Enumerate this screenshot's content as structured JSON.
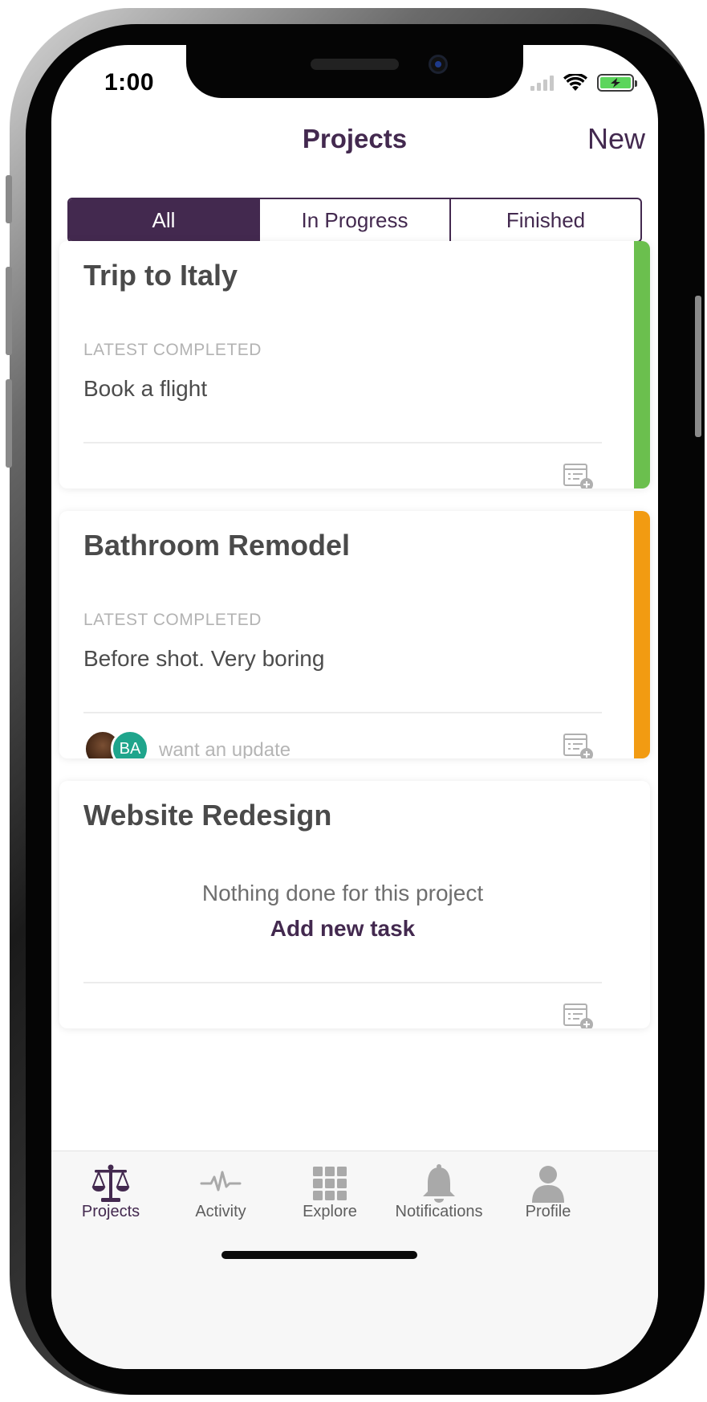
{
  "status_bar": {
    "time": "1:00"
  },
  "nav": {
    "title": "Projects",
    "action": "New"
  },
  "segments": [
    {
      "label": "All",
      "active": true
    },
    {
      "label": "In Progress",
      "active": false
    },
    {
      "label": "Finished",
      "active": false
    }
  ],
  "projects": [
    {
      "title": "Trip to Italy",
      "latest_label": "LATEST COMPLETED",
      "latest_value": "Book a flight",
      "accent_color": "#6bbf4e"
    },
    {
      "title": "Bathroom Remodel",
      "latest_label": "LATEST COMPLETED",
      "latest_value": "Before shot. Very boring",
      "accent_color": "#f29b12",
      "avatar_initials": "BA",
      "update_text": "want an update"
    },
    {
      "title": "Website Redesign",
      "empty_text": "Nothing done for this project",
      "add_task_label": "Add new task"
    }
  ],
  "tabs": [
    {
      "label": "Projects",
      "icon": "scales-icon",
      "active": true
    },
    {
      "label": "Activity",
      "icon": "pulse-icon",
      "active": false
    },
    {
      "label": "Explore",
      "icon": "grid-icon",
      "active": false
    },
    {
      "label": "Notifications",
      "icon": "bell-icon",
      "active": false
    },
    {
      "label": "Profile",
      "icon": "person-icon",
      "active": false
    }
  ],
  "colors": {
    "brand": "#43294f",
    "accent_green": "#6bbf4e",
    "accent_orange": "#f29b12",
    "avatar_teal": "#1fa58c"
  }
}
